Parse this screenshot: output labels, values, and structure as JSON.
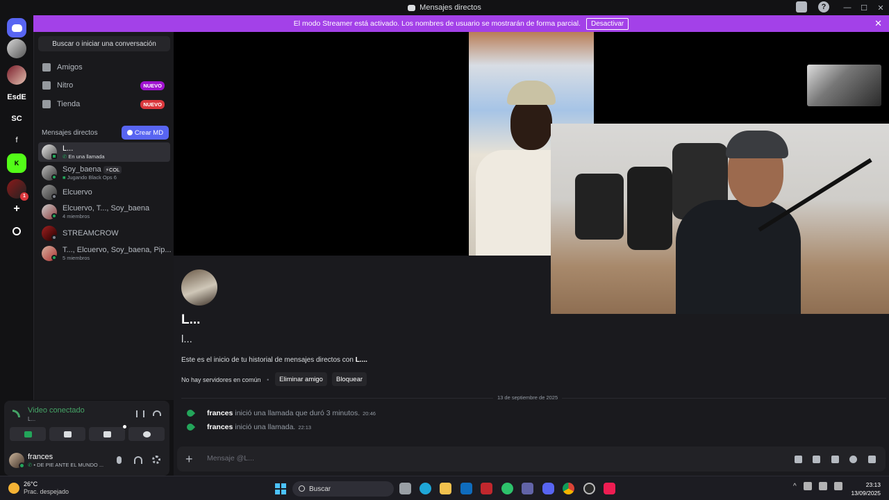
{
  "window": {
    "title": "Mensajes directos"
  },
  "banner": {
    "text": "El modo Streamer está activado. Los nombres de usuario se mostrarán de forma parcial.",
    "button": "Desactivar"
  },
  "servers": {
    "labels": [
      "EsdE",
      "SC",
      "f"
    ],
    "badge": "1"
  },
  "sidebar": {
    "search": "Buscar o iniciar una conversación",
    "nav": [
      {
        "label": "Amigos"
      },
      {
        "label": "Nitro",
        "badge": "NUEVO"
      },
      {
        "label": "Tienda",
        "badge": "NUEVO"
      }
    ],
    "dm_header": "Mensajes directos",
    "create_dm": "Crear MD",
    "dms": [
      {
        "name": "L...",
        "sub": "En una llamada"
      },
      {
        "name": "Soy_baena",
        "tag": "COL",
        "sub": "Jugando Black Ops 6"
      },
      {
        "name": "Elcuervo",
        "sub": ""
      },
      {
        "name": "Elcuervo, T..., Soy_baena",
        "sub": "4 miembros"
      },
      {
        "name": "STREAMCROW",
        "sub": ""
      },
      {
        "name": "T..., Elcuervo, Soy_baena, Pip...",
        "sub": "5 miembros"
      }
    ]
  },
  "voice": {
    "status": "Video conectado",
    "channel": "L..."
  },
  "user": {
    "name": "frances",
    "status": "• DE PIE ANTE EL MUNDO ..."
  },
  "profile": {
    "display_name": "L...",
    "username": "l...",
    "intro_prefix": "Este es el inicio de tu historial de mensajes directos con",
    "intro_name": "L....",
    "no_servers": "No hay servidores en común",
    "remove_friend": "Eliminar amigo",
    "block": "Bloquear"
  },
  "messages": {
    "date": "13 de septiembre de 2025",
    "calls": [
      {
        "user": "frances",
        "text": "inició una llamada que duró 3 minutos.",
        "time": "20:46"
      },
      {
        "user": "frances",
        "text": "inició una llamada.",
        "time": "22:13"
      }
    ]
  },
  "composer": {
    "placeholder": "Mensaje @L..."
  },
  "taskbar": {
    "temp": "26°C",
    "weather": "Prac. despejado",
    "search": "Buscar",
    "time": "23:13",
    "date": "13/09/2025"
  },
  "colors": {
    "accent": "#5865f2",
    "banner": "#a341e8",
    "online": "#23a55a",
    "new_badge_nitro": "#a012cf",
    "new_badge_store": "#da373c"
  }
}
